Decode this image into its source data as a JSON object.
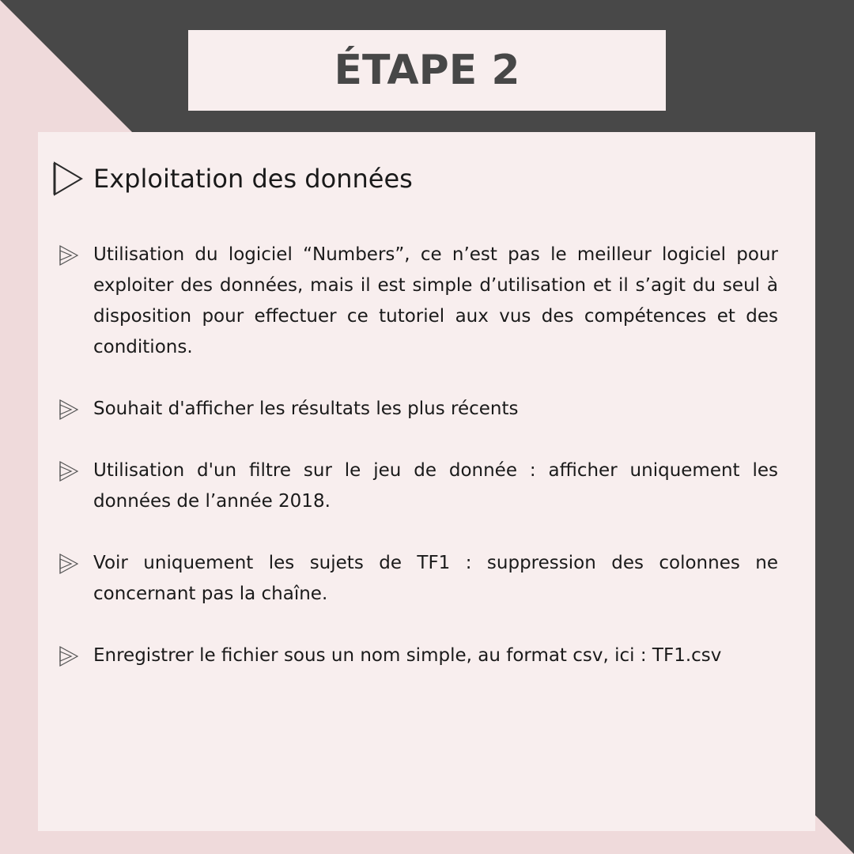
{
  "title": "ÉTAPE 2",
  "heading": "Exploitation des données",
  "bullets": [
    "Utilisation du logiciel “Numbers”, ce n’est pas le meilleur logiciel pour exploiter des données, mais il est simple d’utilisation et il s’agit du seul à disposition pour effectuer ce tutoriel aux vus des compétences et des conditions.",
    "Souhait d'afficher les résultats les plus récents",
    "Utilisation d'un filtre sur le jeu de donnée : afficher uniquement les données de l’année 2018.",
    "Voir uniquement les sujets de TF1 :  suppression des colonnes ne concernant pas la chaîne.",
    "Enregistrer le fichier sous un nom simple, au format csv, ici : TF1.csv"
  ],
  "colors": {
    "background_dark": "#484848",
    "background_pink": "#efdadb",
    "card": "#f8eeee",
    "title_text": "#474747"
  },
  "icons": {
    "heading": "play-triangle-icon",
    "bullet": "layered-triangle-icon"
  }
}
